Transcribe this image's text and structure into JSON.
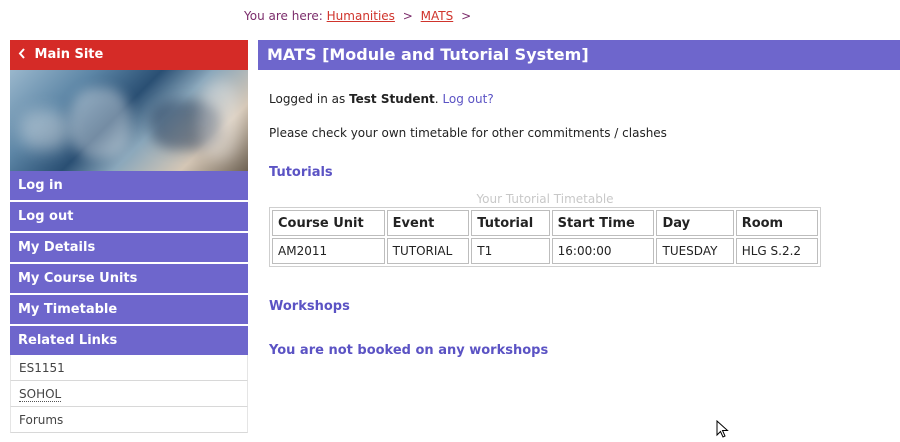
{
  "breadcrumb": {
    "prefix": "You are here:",
    "items": [
      "Humanities",
      "MATS"
    ],
    "separator": ">",
    "trailing": ">"
  },
  "sidebar": {
    "main_site": "Main Site",
    "nav": [
      "Log in",
      "Log out",
      "My Details",
      "My Course Units",
      "My Timetable",
      "Related Links"
    ],
    "links": [
      "ES1151",
      "SOHOL",
      "Forums"
    ]
  },
  "main": {
    "title": "MATS [Module and Tutorial System]",
    "logged_prefix": "Logged in as",
    "user": "Test Student",
    "logout": "Log out?",
    "check_text": "Please check your own timetable for other commitments / clashes",
    "tutorials_title": "Tutorials",
    "table_caption": "Your Tutorial Timetable",
    "table": {
      "headers": [
        "Course Unit",
        "Event",
        "Tutorial",
        "Start Time",
        "Day",
        "Room"
      ],
      "rows": [
        [
          "AM2011",
          "TUTORIAL",
          "T1",
          "16:00:00",
          "TUESDAY",
          "HLG S.2.2"
        ]
      ]
    },
    "workshops_title": "Workshops",
    "not_booked": "You are not booked on any workshops"
  },
  "colors": {
    "red": "#d52b27",
    "purple": "#6e66cc",
    "link_purple": "#5b53c4"
  },
  "icons": {
    "chevron": "chevron-left-icon",
    "cursor": "mouse-pointer-icon"
  }
}
